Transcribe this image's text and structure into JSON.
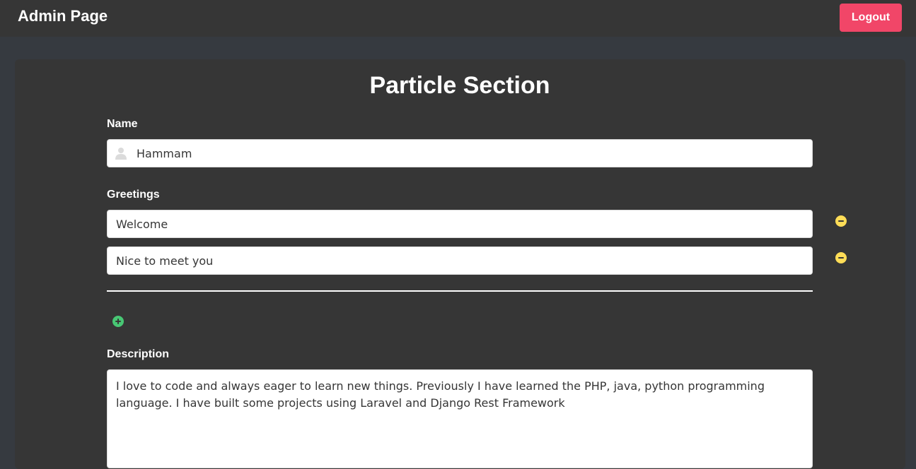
{
  "header": {
    "title": "Admin Page",
    "logout_label": "Logout"
  },
  "section": {
    "title": "Particle Section"
  },
  "name": {
    "label": "Name",
    "value": "Hammam",
    "icon": "user-icon"
  },
  "greetings": {
    "label": "Greetings",
    "items": [
      {
        "value": "Welcome",
        "remove_icon": "minus-circle-icon"
      },
      {
        "value": "Nice to meet you",
        "remove_icon": "minus-circle-icon"
      }
    ],
    "add_icon": "plus-circle-icon"
  },
  "description": {
    "label": "Description",
    "value": "I love to code and always eager to learn new things. Previously I have learned the PHP, java, python programming language. I have built some projects using Laravel and Django Rest Framework"
  },
  "colors": {
    "accent_logout": "#f14668",
    "remove_icon": "#ffdd57",
    "add_icon": "#48c774",
    "navbar": "#363636",
    "page_background": "#363a40"
  }
}
